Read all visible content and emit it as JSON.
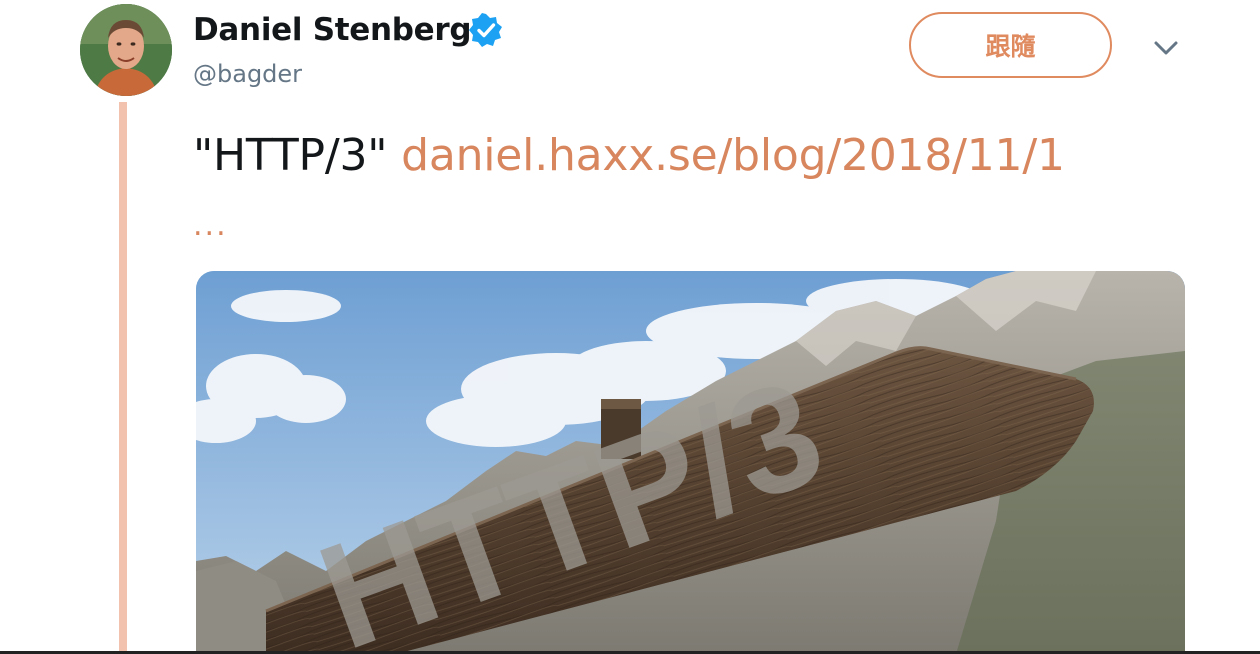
{
  "tweet": {
    "author": {
      "display_name": "Daniel Stenberg",
      "handle": "@bagder",
      "verified": true,
      "avatar_icon": "avatar-photo"
    },
    "follow_label": "跟隨",
    "more_icon": "chevron-down-icon",
    "text_quoted": "\"HTTP/3\"",
    "link_text": "daniel.haxx.se/blog/2018/11/1",
    "link_ellipsis": "...",
    "media": {
      "description_icon": "signpost-image",
      "sign_text": "HTTP/3"
    }
  },
  "colors": {
    "accent": "#e08a5f",
    "link": "#d8865e",
    "thread_line": "#f2c2ae",
    "verified": "#1da1f2",
    "text": "#14171a",
    "muted": "#657786"
  }
}
